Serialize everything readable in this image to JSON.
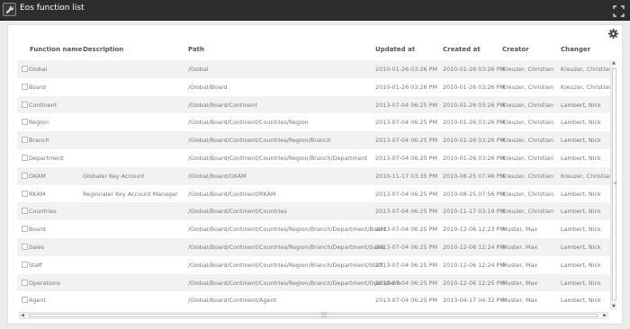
{
  "window": {
    "title": "Eos function list",
    "icon": "wrench-icon",
    "maximize_icon": "expand-icon"
  },
  "toolbar": {
    "settings_icon": "gear-icon"
  },
  "table": {
    "columns": [
      "Function name",
      "Description",
      "Path",
      "Updated at",
      "Created at",
      "Creator",
      "Changer"
    ],
    "rows": [
      {
        "name": "Global",
        "description": "",
        "path": "/Global",
        "updated": "2010-01-26 03:26 PM",
        "created": "2010-01-26 03:26 PM",
        "creator": "Kreuzer, Christian",
        "changer": "Kreuzer, Christian"
      },
      {
        "name": "Board",
        "description": "",
        "path": "/Global/Board",
        "updated": "2010-01-26 03:26 PM",
        "created": "2010-01-26 03:26 PM",
        "creator": "Kreuzer, Christian",
        "changer": "Kreuzer, Christian"
      },
      {
        "name": "Continent",
        "description": "",
        "path": "/Global/Board/Continent",
        "updated": "2013-07-04 06:25 PM",
        "created": "2010-01-26 03:26 PM",
        "creator": "Kreuzer, Christian",
        "changer": "Lambert, Nick"
      },
      {
        "name": "Region",
        "description": "",
        "path": "/Global/Board/Continent/Countries/Region",
        "updated": "2013-07-04 06:25 PM",
        "created": "2010-01-26 03:26 PM",
        "creator": "Kreuzer, Christian",
        "changer": "Lambert, Nick"
      },
      {
        "name": "Branch",
        "description": "",
        "path": "/Global/Board/Continent/Countries/Region/Branch",
        "updated": "2013-07-04 06:25 PM",
        "created": "2010-01-26 03:26 PM",
        "creator": "Kreuzer, Christian",
        "changer": "Lambert, Nick"
      },
      {
        "name": "Department",
        "description": "",
        "path": "/Global/Board/Continent/Countries/Region/Branch/Department",
        "updated": "2013-07-04 06:25 PM",
        "created": "2010-01-26 03:26 PM",
        "creator": "Kreuzer, Christian",
        "changer": "Lambert, Nick"
      },
      {
        "name": "GKAM",
        "description": "Globaler Key Account",
        "path": "/Global/Board/GKAM",
        "updated": "2010-11-17 03:35 PM",
        "created": "2010-08-25 07:46 PM",
        "creator": "Kreuzer, Christian",
        "changer": "Kreuzer, Christian"
      },
      {
        "name": "RKAM",
        "description": "Regionaler Key Account Manager",
        "path": "/Global/Board/Continent/RKAM",
        "updated": "2013-07-04 06:25 PM",
        "created": "2010-08-25 07:56 PM",
        "creator": "Kreuzer, Christian",
        "changer": "Lambert, Nick"
      },
      {
        "name": "Countries",
        "description": "",
        "path": "/Global/Board/Continent/Countries",
        "updated": "2013-07-04 06:25 PM",
        "created": "2010-11-17 03:19 PM",
        "creator": "Kreuzer, Christian",
        "changer": "Lambert, Nick"
      },
      {
        "name": "Board",
        "description": "",
        "path": "/Global/Board/Continent/Countries/Region/Branch/Department/Board",
        "updated": "2013-07-04 06:25 PM",
        "created": "2010-12-06 12:23 PM",
        "creator": "Muster, Max",
        "changer": "Lambert, Nick"
      },
      {
        "name": "Sales",
        "description": "",
        "path": "/Global/Board/Continent/Countries/Region/Branch/Department/Sales",
        "updated": "2013-07-04 06:25 PM",
        "created": "2010-12-06 12:24 PM",
        "creator": "Muster, Max",
        "changer": "Lambert, Nick"
      },
      {
        "name": "Staff",
        "description": "",
        "path": "/Global/Board/Continent/Countries/Region/Branch/Department/Staff",
        "updated": "2013-07-04 06:25 PM",
        "created": "2010-12-06 12:24 PM",
        "creator": "Muster, Max",
        "changer": "Lambert, Nick"
      },
      {
        "name": "Operations",
        "description": "",
        "path": "/Global/Board/Continent/Countries/Region/Branch/Department/Operations",
        "updated": "2013-07-04 06:25 PM",
        "created": "2010-12-06 12:25 PM",
        "creator": "Muster, Max",
        "changer": "Lambert, Nick"
      },
      {
        "name": "Agent",
        "description": "",
        "path": "/Global/Board/Continent/Agent",
        "updated": "2013-07-04 06:25 PM",
        "created": "2013-04-17 04:32 PM",
        "creator": "Muster, Max",
        "changer": "Lambert, Nick"
      }
    ]
  },
  "scrollbars": {
    "vertical_grip": "≡",
    "horizontal_grip": "|||"
  }
}
